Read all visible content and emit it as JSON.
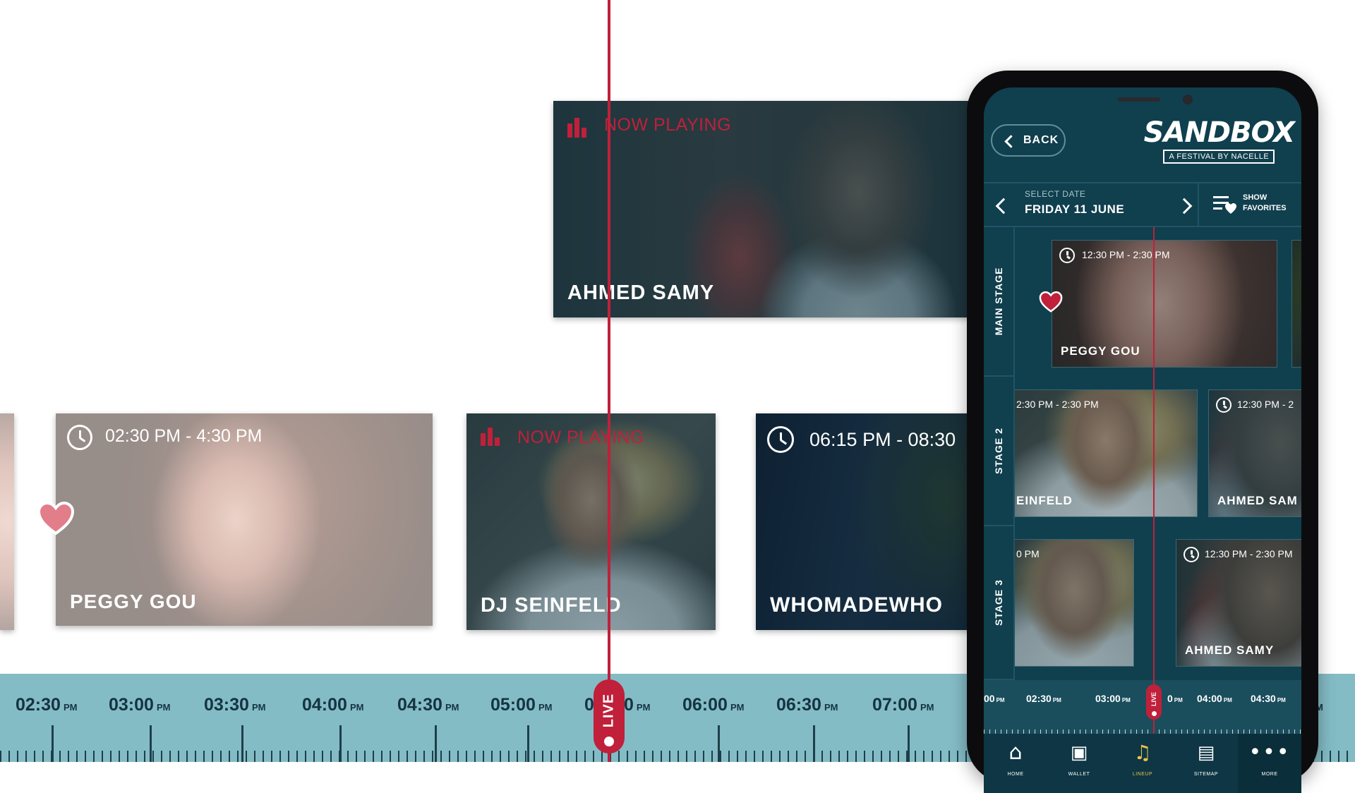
{
  "timeline": {
    "ticks": [
      {
        "time": "02:30",
        "suffix": "PM"
      },
      {
        "time": "03:00",
        "suffix": "PM"
      },
      {
        "time": "03:30",
        "suffix": "PM"
      },
      {
        "time": "04:00",
        "suffix": "PM"
      },
      {
        "time": "04:30",
        "suffix": "PM"
      },
      {
        "time": "05:00",
        "suffix": "PM"
      },
      {
        "time": "0",
        "suffix": ""
      },
      {
        "time": "0",
        "suffix": "PM"
      },
      {
        "time": "06:00",
        "suffix": "PM"
      },
      {
        "time": "06:30",
        "suffix": "PM"
      },
      {
        "time": "07:00",
        "suffix": "PM"
      },
      {
        "time": "",
        "suffix": "M"
      }
    ],
    "live_label": "LIVE"
  },
  "cards": {
    "ahmed_top": {
      "status": "NOW PLAYING",
      "name": "AHMED SAMY"
    },
    "peggy": {
      "time": "02:30 PM - 4:30 PM",
      "name": "PEGGY GOU"
    },
    "seinfeld": {
      "status": "NOW PLAYING",
      "name": "DJ SEINFELD"
    },
    "whomadewho": {
      "time": "06:15 PM - 08:30",
      "name": "WHOMADEWHO"
    }
  },
  "phone": {
    "back_label": "BACK",
    "logo_title": "SANDBOX",
    "logo_subtitle": "A FESTIVAL BY NACELLE",
    "date_label": "SELECT DATE",
    "date_value": "FRIDAY 11 JUNE",
    "favorites_line1": "SHOW",
    "favorites_line2": "FAVORITES",
    "stages": [
      "MAIN STAGE",
      "STAGE 2",
      "STAGE 3"
    ],
    "cards": {
      "main_peggy": {
        "time": "12:30 PM - 2:30 PM",
        "name": "PEGGY GOU"
      },
      "s2_seinfeld": {
        "time": "2:30 PM - 2:30 PM",
        "name": "EINFELD"
      },
      "s2_ahmed": {
        "time": "12:30 PM - 2",
        "name": "AHMED SAM"
      },
      "s3_seinfeld": {
        "time": "0 PM"
      },
      "s3_ahmed": {
        "time": "12:30 PM - 2:30 PM",
        "name": "AHMED SAMY"
      }
    },
    "ticks": [
      {
        "time": "00",
        "suffix": "PM"
      },
      {
        "time": "02:30",
        "suffix": "PM"
      },
      {
        "time": "03:00",
        "suffix": "PM"
      },
      {
        "time": "0",
        "suffix": "PM"
      },
      {
        "time": "04:00",
        "suffix": "PM"
      },
      {
        "time": "04:30",
        "suffix": "PM"
      }
    ],
    "live_label": "LIVE",
    "nav": [
      {
        "label": "HOME",
        "icon": "home-icon"
      },
      {
        "label": "WALLET",
        "icon": "wallet-icon"
      },
      {
        "label": "LINEUP",
        "icon": "lineup-icon",
        "active": true
      },
      {
        "label": "SITEMAP",
        "icon": "map-icon"
      },
      {
        "label": "MORE",
        "icon": "more-icon"
      }
    ]
  },
  "colors": {
    "accent_red": "#c0203a",
    "timeline_bg": "#84bcc6",
    "phone_bg": "#103f4e",
    "active_nav": "#e8c44a"
  }
}
